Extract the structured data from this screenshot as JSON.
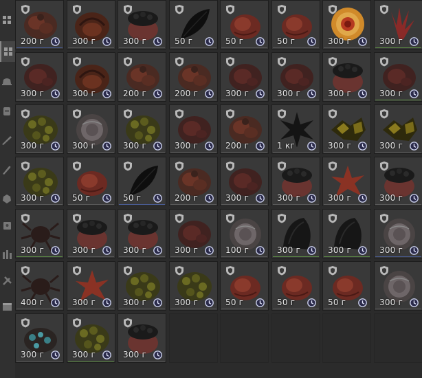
{
  "sidebar": {
    "items": [
      {
        "icon": "grid-icon",
        "active": false
      },
      {
        "icon": "grid-icon",
        "active": true
      },
      {
        "icon": "hat-icon",
        "active": false
      },
      {
        "icon": "backpack-icon",
        "active": false
      },
      {
        "icon": "rifle-icon",
        "active": false
      },
      {
        "icon": "knife-icon",
        "active": false
      },
      {
        "icon": "ore-icon",
        "active": false
      },
      {
        "icon": "bag-icon",
        "active": false
      },
      {
        "icon": "bottles-icon",
        "active": false
      },
      {
        "icon": "tools-icon",
        "active": false
      },
      {
        "icon": "box-icon",
        "active": false
      }
    ]
  },
  "inventory": {
    "rows": [
      [
        {
          "weight": "200 г",
          "art": "meat-brown",
          "line": "blue"
        },
        {
          "weight": "300 г",
          "art": "pumpkin-meat",
          "line": "gray"
        },
        {
          "weight": "300 г",
          "art": "meat-dark-top",
          "line": "gray"
        },
        {
          "weight": "50 г",
          "art": "black-leaf",
          "line": "gray"
        },
        {
          "weight": "50 г",
          "art": "red-round",
          "line": "gray"
        },
        {
          "weight": "50 г",
          "art": "red-round",
          "line": "gray"
        },
        {
          "weight": "300 г",
          "art": "orange-ring",
          "line": "gray"
        },
        {
          "weight": "300 г",
          "art": "red-spikes",
          "line": "green"
        }
      ],
      [
        {
          "weight": "300 г",
          "art": "meat-dark",
          "line": "gray"
        },
        {
          "weight": "300 г",
          "art": "pumpkin-meat",
          "line": "gray"
        },
        {
          "weight": "200 г",
          "art": "meat-brown",
          "line": "gray"
        },
        {
          "weight": "200 г",
          "art": "meat-brown",
          "line": "gray"
        },
        {
          "weight": "300 г",
          "art": "meat-dark",
          "line": "gray"
        },
        {
          "weight": "300 г",
          "art": "meat-dark",
          "line": "gray"
        },
        {
          "weight": "300 г",
          "art": "meat-dark-top",
          "line": "gray"
        },
        {
          "weight": "300 г",
          "art": "meat-dark",
          "line": "green"
        }
      ],
      [
        {
          "weight": "300 г",
          "art": "mossy",
          "line": "gray"
        },
        {
          "weight": "300 г",
          "art": "gray-flower",
          "line": "gray"
        },
        {
          "weight": "300 г",
          "art": "mossy",
          "line": "gray"
        },
        {
          "weight": "300 г",
          "art": "meat-dark",
          "line": "gray"
        },
        {
          "weight": "200 г",
          "art": "meat-brown",
          "line": "gray"
        },
        {
          "weight": "1 кг",
          "art": "black-star",
          "line": "gray"
        },
        {
          "weight": "300 г",
          "art": "gold-chunks",
          "line": "gray"
        },
        {
          "weight": "300 г",
          "art": "gold-chunks",
          "line": "gray"
        }
      ],
      [
        {
          "weight": "300 г",
          "art": "mossy",
          "line": "gray"
        },
        {
          "weight": "50 г",
          "art": "red-round",
          "line": "gray"
        },
        {
          "weight": "50 г",
          "art": "black-leaf",
          "line": "blue"
        },
        {
          "weight": "200 г",
          "art": "meat-brown",
          "line": "gray"
        },
        {
          "weight": "300 г",
          "art": "meat-dark",
          "line": "gray"
        },
        {
          "weight": "300 г",
          "art": "meat-dark-top",
          "line": "gray"
        },
        {
          "weight": "300 г",
          "art": "red-star",
          "line": "gray"
        },
        {
          "weight": "300 г",
          "art": "meat-dark-top",
          "line": "gray"
        }
      ],
      [
        {
          "weight": "300 г",
          "art": "dark-spider",
          "line": "green"
        },
        {
          "weight": "300 г",
          "art": "meat-dark-top",
          "line": "gray"
        },
        {
          "weight": "300 г",
          "art": "meat-dark-top",
          "line": "gray"
        },
        {
          "weight": "300 г",
          "art": "meat-dark",
          "line": "gray"
        },
        {
          "weight": "100 г",
          "art": "gray-flower",
          "line": "gray"
        },
        {
          "weight": "300 г",
          "art": "black-shell",
          "line": "green"
        },
        {
          "weight": "300 г",
          "art": "black-shell",
          "line": "green"
        },
        {
          "weight": "300 г",
          "art": "gray-flower",
          "line": "blue"
        }
      ],
      [
        {
          "weight": "400 г",
          "art": "dark-spider",
          "line": "gray"
        },
        {
          "weight": "300 г",
          "art": "red-star",
          "line": "gray"
        },
        {
          "weight": "300 г",
          "art": "mossy",
          "line": "gray"
        },
        {
          "weight": "300 г",
          "art": "mossy",
          "line": "gray"
        },
        {
          "weight": "50 г",
          "art": "red-round",
          "line": "gray"
        },
        {
          "weight": "50 г",
          "art": "red-round",
          "line": "gray"
        },
        {
          "weight": "50 г",
          "art": "red-round",
          "line": "gray"
        },
        {
          "weight": "300 г",
          "art": "gray-flower",
          "line": "gray"
        }
      ],
      [
        {
          "weight": "300 г",
          "art": "teal-crystals",
          "line": "gray"
        },
        {
          "weight": "300 г",
          "art": "mossy",
          "line": "green"
        },
        {
          "weight": "300 г",
          "art": "meat-dark-top",
          "line": "gray"
        },
        null,
        null,
        null,
        null,
        null
      ]
    ]
  }
}
